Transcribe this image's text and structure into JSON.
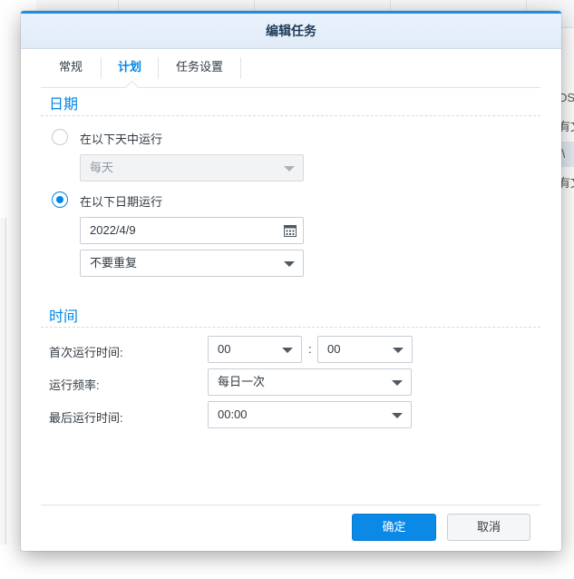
{
  "background": {
    "right_rows": [
      "DS",
      "有文",
      "/\\",
      "有文"
    ]
  },
  "dialog": {
    "title": "编辑任务",
    "tabs": [
      {
        "label": "常规",
        "active": false
      },
      {
        "label": "计划",
        "active": true
      },
      {
        "label": "任务设置",
        "active": false
      }
    ]
  },
  "date_section": {
    "title": "日期",
    "option_days": {
      "label": "在以下天中运行",
      "selected": false
    },
    "days_select": {
      "value": "每天",
      "disabled": true
    },
    "option_date": {
      "label": "在以下日期运行",
      "selected": true
    },
    "date_input": {
      "value": "2022/4/9",
      "icon": "calendar-icon"
    },
    "repeat_select": {
      "value": "不要重复"
    }
  },
  "time_section": {
    "title": "时间",
    "first_run": {
      "label": "首次运行时间:",
      "hour": "00",
      "separator": ":",
      "minute": "00"
    },
    "frequency": {
      "label": "运行频率:",
      "value": "每日一次"
    },
    "last_run": {
      "label": "最后运行时间:",
      "value": "00:00"
    }
  },
  "buttons": {
    "ok": "确定",
    "cancel": "取消"
  },
  "colors": {
    "accent": "#0086e5",
    "primary_button": "#0a8ae6"
  }
}
